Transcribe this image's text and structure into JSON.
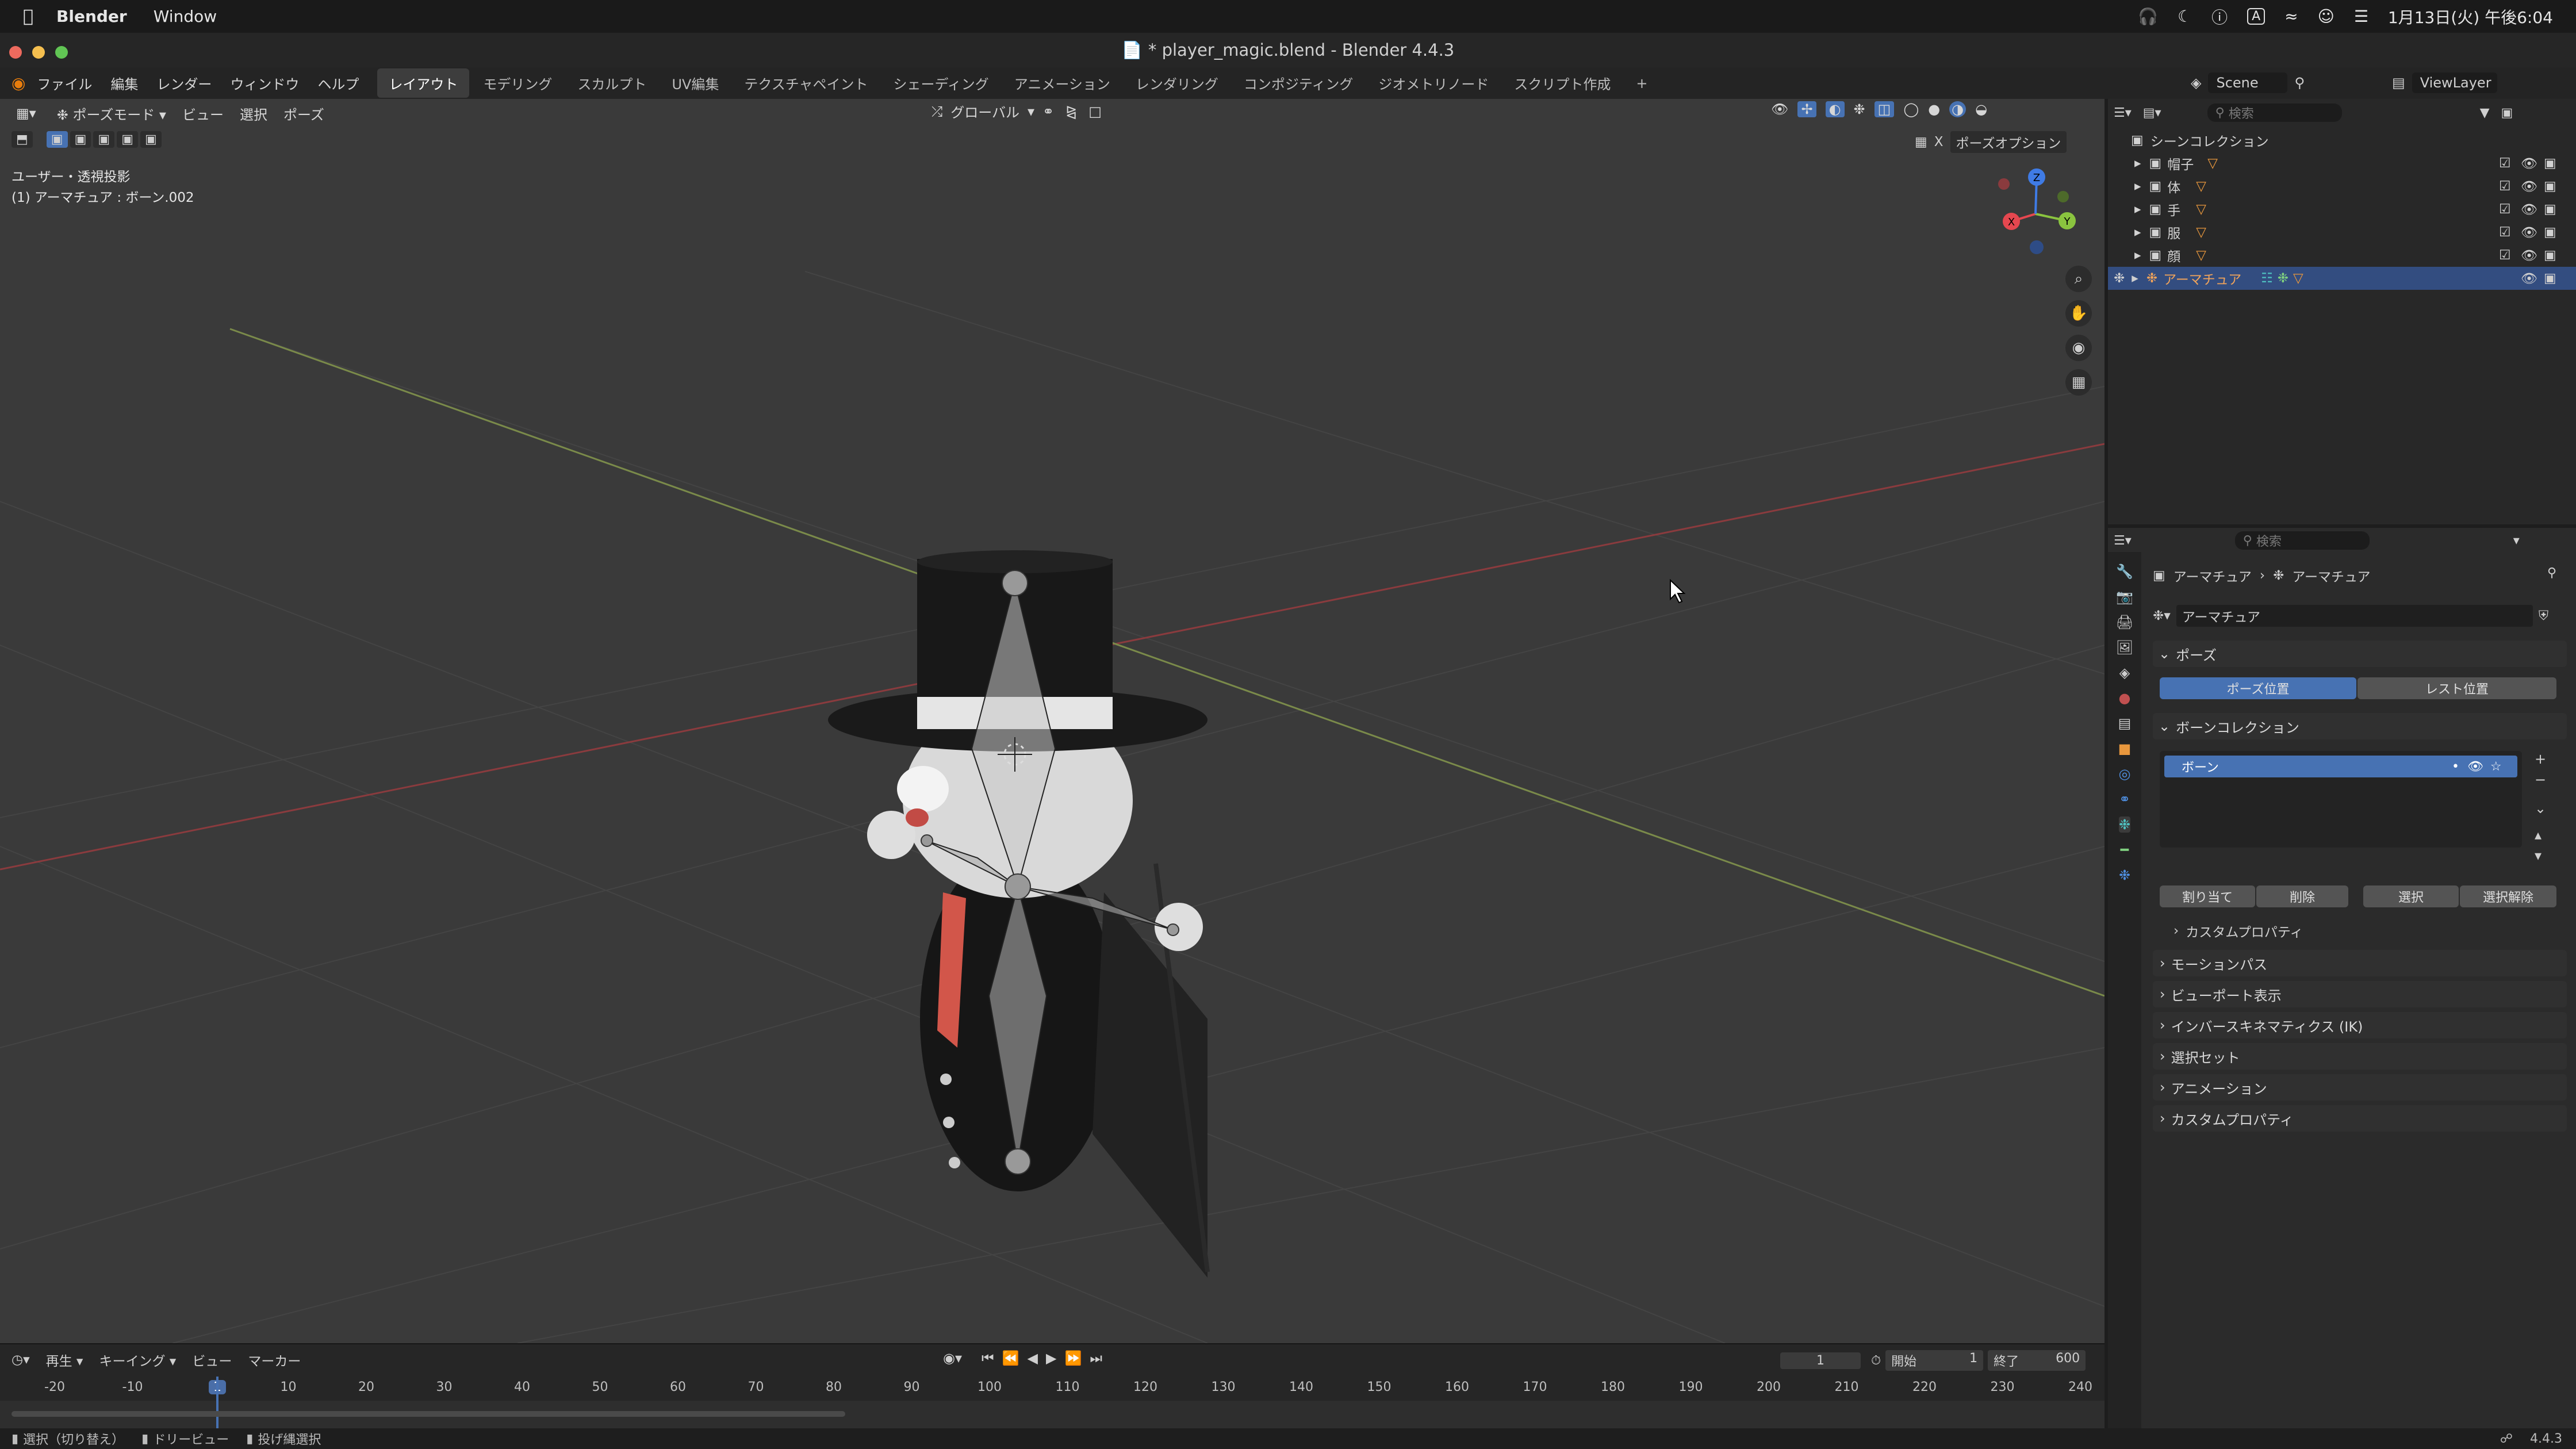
{
  "menubar": {
    "apple": "",
    "app_name": "Blender",
    "window_menu": "Window",
    "clock": "1月13日(火) 午後6:04",
    "input_indicator": "A"
  },
  "window": {
    "title": "* player_magic.blend - Blender 4.4.3"
  },
  "topbar": {
    "menus": [
      "ファイル",
      "編集",
      "レンダー",
      "ウィンドウ",
      "ヘルプ"
    ],
    "workspaces": [
      "レイアウト",
      "モデリング",
      "スカルプト",
      "UV編集",
      "テクスチャペイント",
      "シェーディング",
      "アニメーション",
      "レンダリング",
      "コンポジティング",
      "ジオメトリノード",
      "スクリプト作成"
    ],
    "add_tab": "+",
    "scene_label": "Scene",
    "viewlayer_label": "ViewLayer"
  },
  "viewport": {
    "mode": "ポーズモード",
    "menus": [
      "ビュー",
      "選択",
      "ポーズ"
    ],
    "transform_orientation": "グローバル",
    "pose_options": "ポーズオプション",
    "info_line1": "ユーザー・透視投影",
    "info_line2": "(1) アーマチュア : ボーン.002",
    "gizmo_x": "X",
    "gizmo_y": "Y",
    "gizmo_z": "Z",
    "x_toggle": "X"
  },
  "outliner": {
    "search_placeholder": "検索",
    "scene_collection": "シーンコレクション",
    "items": [
      {
        "name": "帽子"
      },
      {
        "name": "体"
      },
      {
        "name": "手"
      },
      {
        "name": "服"
      },
      {
        "name": "顔"
      },
      {
        "name": "アーマチュア"
      }
    ]
  },
  "properties": {
    "search_placeholder": "検索",
    "breadcrumb_a": "アーマチュア",
    "breadcrumb_b": "アーマチュア",
    "data_name": "アーマチュア",
    "pose_panel": "ポーズ",
    "pose_position": "ポーズ位置",
    "rest_position": "レスト位置",
    "bone_collection_panel": "ボーンコレクション",
    "bone_collection_item": "ボーン",
    "assign": "割り当て",
    "remove": "削除",
    "select": "選択",
    "deselect": "選択解除",
    "custom_props_sub": "カスタムプロパティ",
    "panels": [
      "モーションパス",
      "ビューポート表示",
      "インバースキネマティクス (IK)",
      "選択セット",
      "アニメーション",
      "カスタムプロパティ"
    ]
  },
  "timeline": {
    "menus": [
      "再生",
      "キーイング",
      "ビュー",
      "マーカー"
    ],
    "current_frame": "1",
    "start_label": "開始",
    "start": "1",
    "end_label": "終了",
    "end": "600",
    "ticks": [
      "-20",
      "-10",
      "1",
      "10",
      "20",
      "30",
      "40",
      "50",
      "60",
      "70",
      "80",
      "90",
      "100",
      "110",
      "120",
      "130",
      "140",
      "150",
      "160",
      "170",
      "180",
      "190",
      "200",
      "210",
      "220",
      "230",
      "240"
    ]
  },
  "statusbar": {
    "select": "選択（切り替え）",
    "dolly": "ドリービュー",
    "lasso": "投げ縄選択",
    "version": "4.4.3"
  },
  "colors": {
    "accent": "#4772b3",
    "active_frame": "#4a6ea8",
    "x_axis": "#e5474f",
    "y_axis": "#8ac43f",
    "z_axis": "#3f7be5"
  }
}
